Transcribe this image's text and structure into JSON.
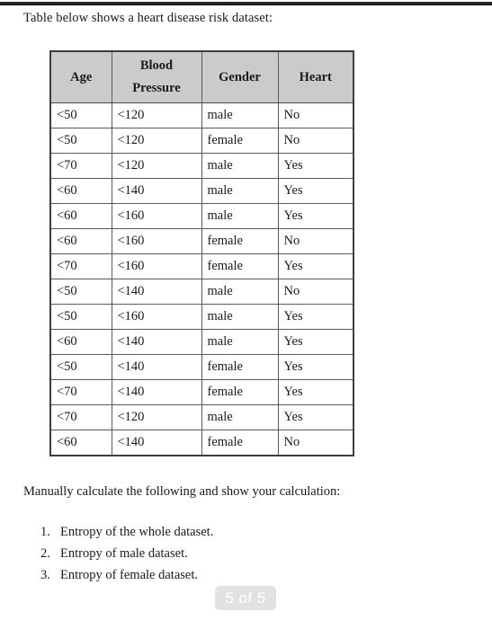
{
  "document": {
    "intro_text": "Table below shows a heart disease risk dataset:",
    "prompt_text": "Manually calculate the following and show your calculation:"
  },
  "table": {
    "headers": [
      {
        "line1": "Age",
        "line2": ""
      },
      {
        "line1": "Blood",
        "line2": "Pressure"
      },
      {
        "line1": "Gender",
        "line2": ""
      },
      {
        "line1": "Heart",
        "line2": ""
      }
    ],
    "header_background": "#cbcbcb",
    "rows": [
      {
        "age": "<50",
        "blood_pressure": "<120",
        "gender": "male",
        "heart": "No"
      },
      {
        "age": "<50",
        "blood_pressure": "<120",
        "gender": "female",
        "heart": "No"
      },
      {
        "age": "<70",
        "blood_pressure": "<120",
        "gender": "male",
        "heart": "Yes"
      },
      {
        "age": "<60",
        "blood_pressure": "<140",
        "gender": "male",
        "heart": "Yes"
      },
      {
        "age": "<60",
        "blood_pressure": "<160",
        "gender": "male",
        "heart": "Yes"
      },
      {
        "age": "<60",
        "blood_pressure": "<160",
        "gender": "female",
        "heart": "No"
      },
      {
        "age": "<70",
        "blood_pressure": "<160",
        "gender": "female",
        "heart": "Yes"
      },
      {
        "age": "<50",
        "blood_pressure": "<140",
        "gender": "male",
        "heart": "No"
      },
      {
        "age": "<50",
        "blood_pressure": "<160",
        "gender": "male",
        "heart": "Yes"
      },
      {
        "age": "<60",
        "blood_pressure": "<140",
        "gender": "male",
        "heart": "Yes"
      },
      {
        "age": "<50",
        "blood_pressure": "<140",
        "gender": "female",
        "heart": "Yes"
      },
      {
        "age": "<70",
        "blood_pressure": "<140",
        "gender": "female",
        "heart": "Yes"
      },
      {
        "age": "<70",
        "blood_pressure": "<120",
        "gender": "male",
        "heart": "Yes"
      },
      {
        "age": "<60",
        "blood_pressure": "<140",
        "gender": "female",
        "heart": "No"
      }
    ]
  },
  "questions": [
    {
      "number": "1.",
      "text": "Entropy of the whole dataset."
    },
    {
      "number": "2.",
      "text": "Entropy of male dataset."
    },
    {
      "number": "3.",
      "text": "Entropy of female dataset."
    }
  ],
  "page_indicator": {
    "label": "5 of 5"
  }
}
